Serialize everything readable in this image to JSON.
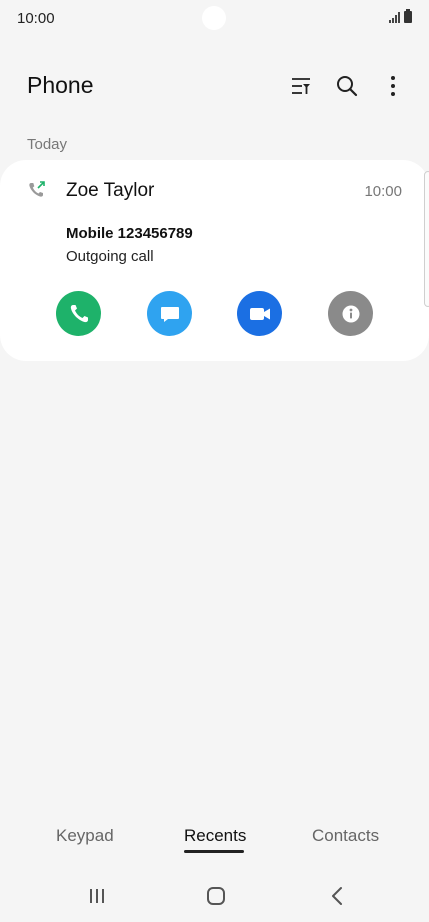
{
  "status_bar": {
    "time": "10:00"
  },
  "app_bar": {
    "title": "Phone",
    "actions": [
      "filter-icon",
      "search-icon",
      "more-options-icon"
    ]
  },
  "section": {
    "label": "Today"
  },
  "call_log": [
    {
      "name": "Zoe Taylor",
      "time": "10:00",
      "number": "Mobile 123456789",
      "status": "Outgoing call",
      "call_type_icon": "outgoing-call-icon",
      "actions": [
        {
          "icon": "phone-icon",
          "color": "#1eb26a"
        },
        {
          "icon": "message-icon",
          "color": "#2fa3f0"
        },
        {
          "icon": "video-call-icon",
          "color": "#1b6fe3"
        },
        {
          "icon": "info-icon",
          "color": "#8a8a8a"
        }
      ]
    }
  ],
  "bottom_tabs": [
    {
      "label": "Keypad",
      "active": false
    },
    {
      "label": "Recents",
      "active": true
    },
    {
      "label": "Contacts",
      "active": false
    }
  ],
  "nav_bar": [
    "recent-apps-icon",
    "home-icon",
    "back-icon"
  ]
}
